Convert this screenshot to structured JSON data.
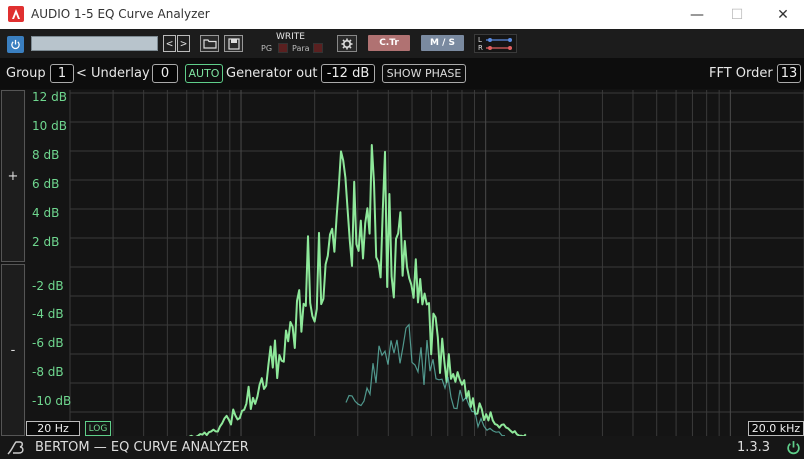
{
  "window": {
    "title": "AUDIO 1-5 EQ Curve Analyzer",
    "minimize_glyph": "—",
    "maximize_glyph": "☐",
    "close_glyph": "✕"
  },
  "toolbar": {
    "preset_value": "",
    "prev_glyph": "<",
    "next_glyph": ">",
    "write_label": "WRITE",
    "pg_label": "PG",
    "para_label": "Para",
    "ctr_label": "C.Tr",
    "ms_label": "M / S",
    "lr_left": "L",
    "lr_right": "R"
  },
  "controls": {
    "group_label": "Group",
    "group_value": "1",
    "underlay_label": "< Underlay",
    "underlay_value": "0",
    "auto_label": "AUTO",
    "generator_label": "Generator out",
    "generator_value": "-12 dB",
    "show_phase_label": "SHOW PHASE",
    "fft_label": "FFT Order",
    "fft_value": "13"
  },
  "graph": {
    "plus_label": "+",
    "minus_label": "-",
    "db_labels": [
      "12 dB",
      "10 dB",
      "8 dB",
      "6 dB",
      "4 dB",
      "2 dB",
      "-2 dB",
      "-4 dB",
      "-6 dB",
      "-8 dB",
      "-10 dB"
    ],
    "min_freq": "20 Hz",
    "max_freq": "20.0 kHz",
    "log_label": "LOG",
    "curve_color": "#8ee89a",
    "curve_secondary_color": "#6ad0c0",
    "grid_color": "#3a3a3a"
  },
  "footer": {
    "brand": "BERTOM — EQ CURVE ANALYZER",
    "version": "1.3.3"
  },
  "colors": {
    "accent_blue": "#3a7fc0",
    "accent_green": "#6fd78f",
    "ctr_button": "#b07272",
    "ms_button": "#7a8aa0"
  }
}
